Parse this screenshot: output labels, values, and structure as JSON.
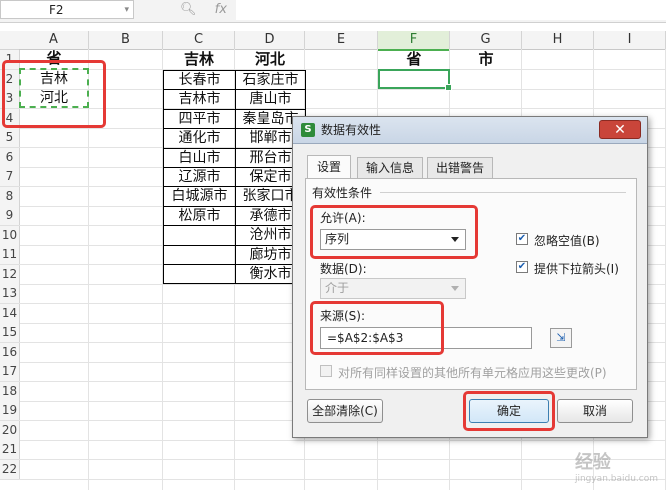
{
  "formula_bar": {
    "name_box": "F2",
    "fx_label": "fx"
  },
  "columns": [
    "A",
    "B",
    "C",
    "D",
    "E",
    "F",
    "G",
    "H",
    "I"
  ],
  "rows": [
    "1",
    "2",
    "3",
    "4",
    "5",
    "6",
    "7",
    "8",
    "9",
    "10",
    "11",
    "12",
    "13",
    "14",
    "15",
    "16",
    "17",
    "18",
    "19",
    "20",
    "21",
    "22"
  ],
  "cells": {
    "A1": "省",
    "A2": "吉林",
    "A3": "河北",
    "C1": "吉林",
    "D1": "河北",
    "F1": "省",
    "G1": "市",
    "C": [
      "长春市",
      "吉林市",
      "四平市",
      "通化市",
      "白山市",
      "辽源市",
      "白城源市",
      "松原市"
    ],
    "D": [
      "石家庄市",
      "唐山市",
      "秦皇岛市",
      "邯郸市",
      "邢台市",
      "保定市",
      "张家口市",
      "承德市",
      "沧州市",
      "廊坊市",
      "衡水市"
    ]
  },
  "dialog": {
    "title": "数据有效性",
    "app_icon": "S",
    "tabs": [
      "设置",
      "输入信息",
      "出错警告"
    ],
    "section": "有效性条件",
    "allow_label": "允许(A):",
    "allow_value": "序列",
    "data_label": "数据(D):",
    "data_value": "介于",
    "ignore_blank": "忽略空值(B)",
    "dropdown": "提供下拉箭头(I)",
    "source_label": "来源(S):",
    "source_value": "=$A$2:$A$3",
    "apply_all": "对所有同样设置的其他所有单元格应用这些更改(P)",
    "clear_all": "全部清除(C)",
    "ok": "确定",
    "cancel": "取消"
  },
  "watermark": {
    "text": "经验",
    "sub": "jingyan.baidu.com"
  }
}
